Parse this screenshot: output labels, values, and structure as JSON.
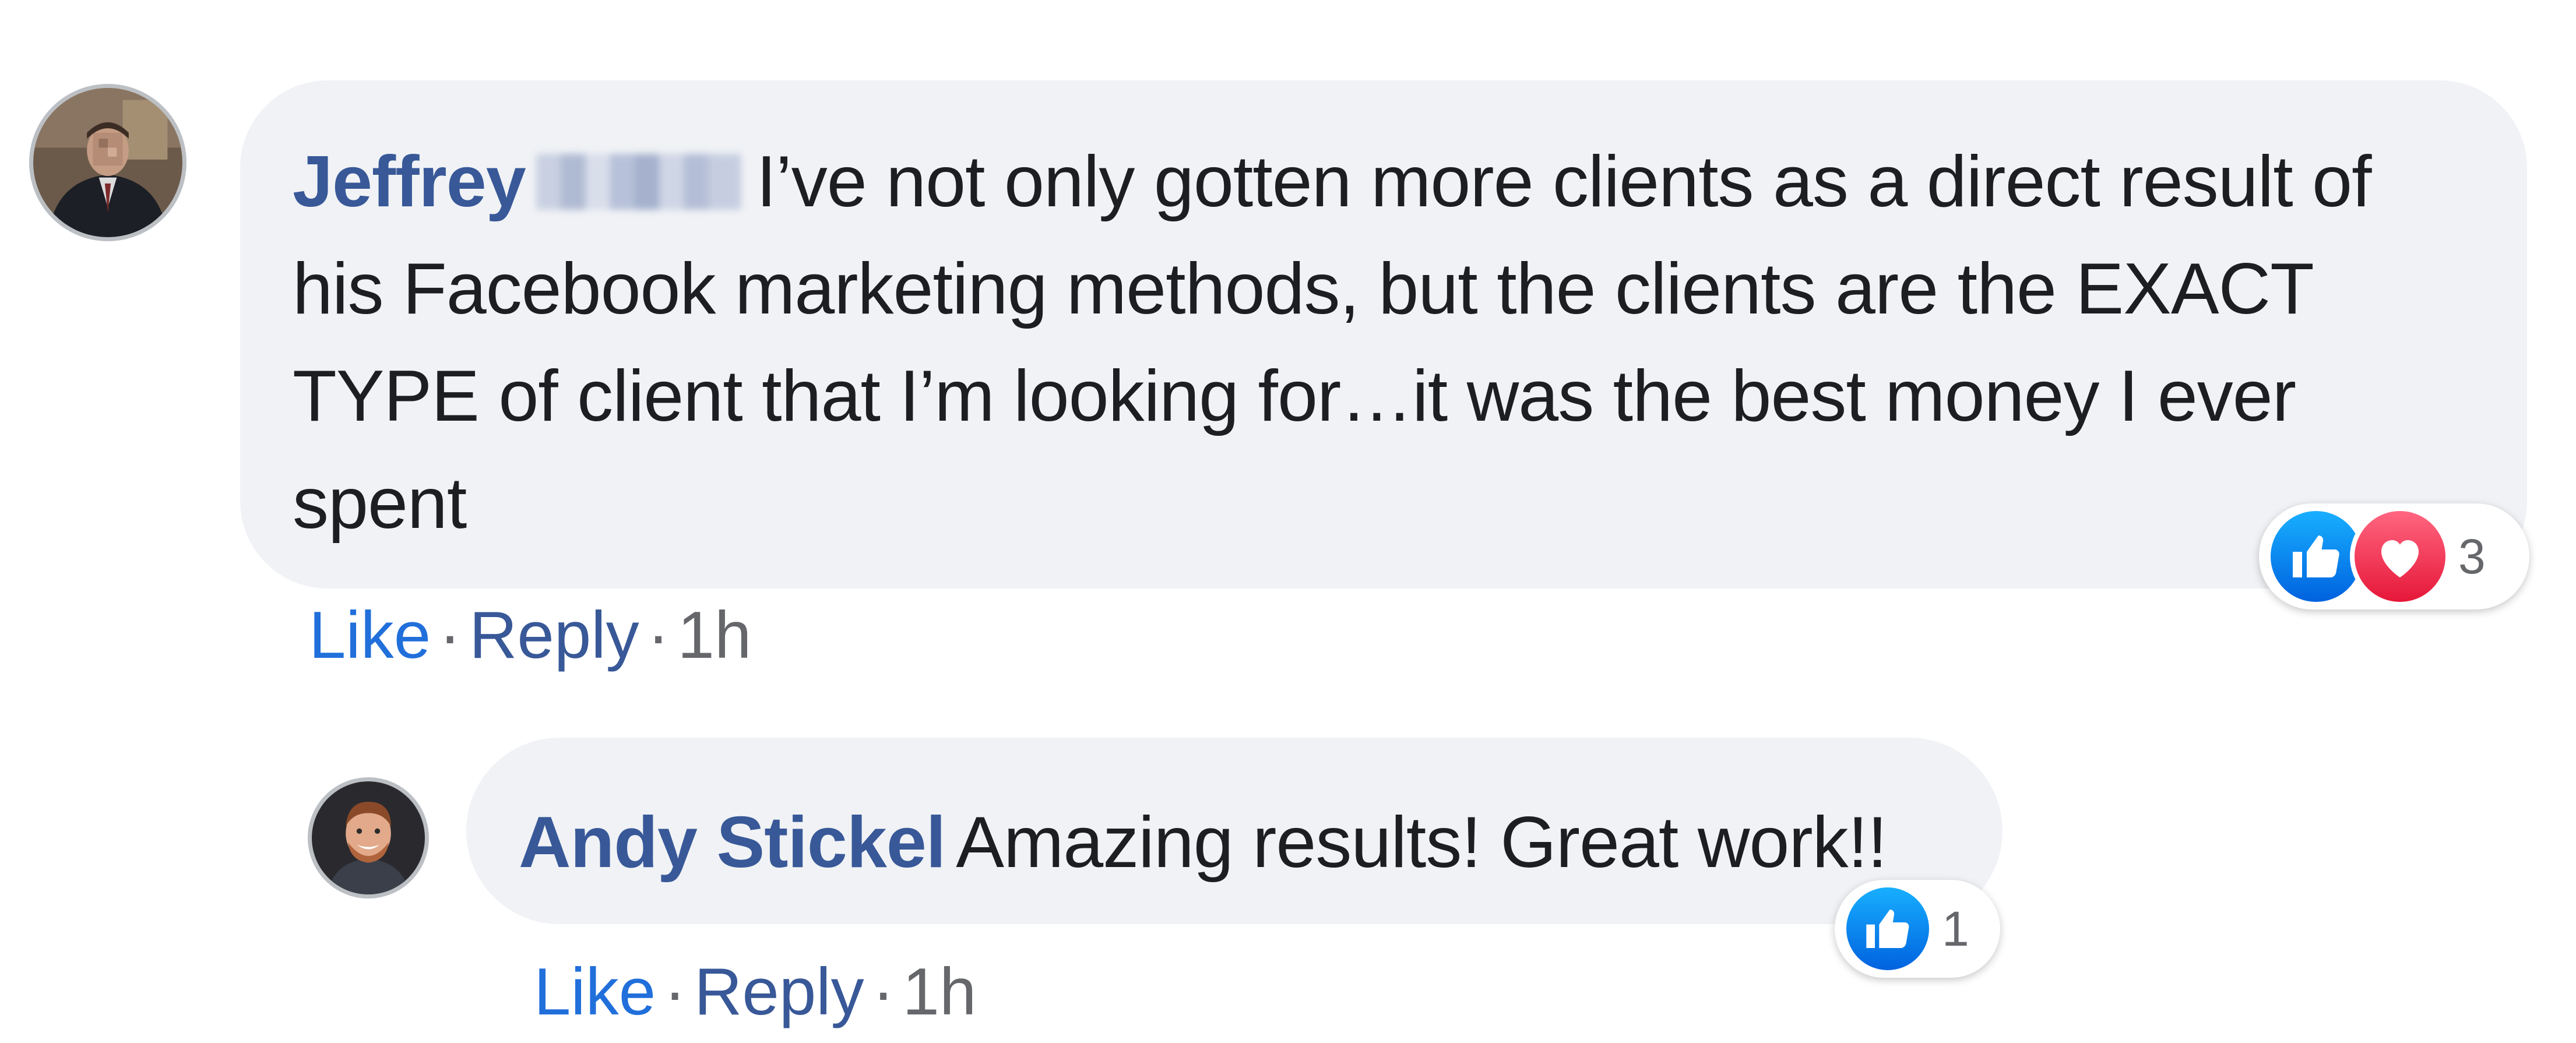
{
  "comments": [
    {
      "author_first": "Jeffrey",
      "text": "I’ve not only gotten more clients as a direct result of his Facebook marketing methods, but the clients are the EXACT TYPE of client that I’m looking for…it was the best money I ever spent",
      "reactions": {
        "icons": [
          "like-icon",
          "love-icon"
        ],
        "count": "3"
      },
      "actions": {
        "like": "Like",
        "reply": "Reply",
        "separator": "·",
        "time": "1h"
      }
    },
    {
      "author": "Andy Stickel",
      "text": "Amazing results! Great work!!",
      "reactions": {
        "icons": [
          "like-icon"
        ],
        "count": "1"
      },
      "actions": {
        "like": "Like",
        "reply": "Reply",
        "separator": "·",
        "time": "1h"
      }
    }
  ],
  "colors": {
    "bubble": "#f0f2f5",
    "author": "#385898",
    "link": "#216fdb",
    "meta": "#65676b",
    "like": "#1877f2",
    "love": "#f33e58"
  }
}
